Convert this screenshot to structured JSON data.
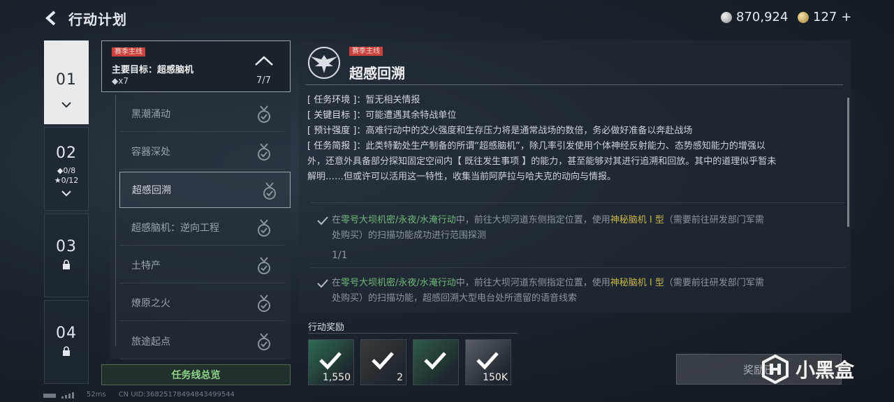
{
  "header": {
    "title": "行动计划",
    "silver": "870,924",
    "gold": "127",
    "gold_plus": "+"
  },
  "chapters": [
    {
      "num": "01",
      "sub1": "",
      "sub2": ""
    },
    {
      "num": "02",
      "sub1": "◆0/8",
      "sub2": "★0/12"
    },
    {
      "num": "03",
      "sub1": "",
      "sub2": ""
    },
    {
      "num": "04",
      "sub1": "",
      "sub2": ""
    }
  ],
  "main_quest": {
    "tag": "赛季主线",
    "title": "主要目标：超感脑机",
    "reward": "◆x7",
    "progress": "7/7"
  },
  "missions": [
    {
      "label": "黑潮涌动"
    },
    {
      "label": "容器深处"
    },
    {
      "label": "超感回溯"
    },
    {
      "label": "超感脑机：逆向工程"
    },
    {
      "label": "土特产"
    },
    {
      "label": "燎原之火"
    },
    {
      "label": "旅途起点"
    }
  ],
  "overview_label": "任务线总览",
  "detail": {
    "tag": "赛季主线",
    "title": "超感回溯",
    "env_k": "[ 任务环境 ]：",
    "env_v": "暂无相关情报",
    "target_k": "[ 关键目标 ]：",
    "target_v": "可能遭遇其余特战单位",
    "strength_k": "[ 预计强度 ]：",
    "strength_v": "高难行动中的交火强度和生存压力将是通常战场的数倍，务必做好准备以奔赴战场",
    "brief_k": "[ 任务简报 ]：",
    "brief_v1": "此类特勤处生产制备的所谓“超感脑机”，除几率引发使用个体神经反射能力、态势感知能力的增强以",
    "brief_v2": "外，还意外具备部分探知固定空间内【 既往发生事项 】的能力，甚至能够对其进行追溯和回放。其中的道理似乎暂未",
    "brief_v3": "解明……但或许可以活用这一特性，收集当前阿萨拉与哈夫克的动向与情报。"
  },
  "objectives": [
    {
      "pre": "在",
      "map": "零号大坝机密/永夜/水淹行动",
      "mid": "中，前往大坝河道东侧指定位置，使用",
      "item": "神秘脑机 I 型",
      "post": "（需要前往研发部门军需",
      "line2": "处购买）的扫描功能成功进行范围探测",
      "progress": "1/1"
    },
    {
      "pre": "在",
      "map": "零号大坝机密/永夜/水淹行动",
      "mid": "中，前往大坝河道东侧指定位置，使用",
      "item": "神秘脑机 I 型",
      "post": "（需要前往研发部门军需",
      "line2": "处购买）的扫描功能，超感回溯大型电台处所遗留的语音线索",
      "progress": ""
    }
  ],
  "rewards": {
    "title": "行动奖励",
    "items": [
      {
        "count": "1,550",
        "color": "#2f6b55"
      },
      {
        "count": "2",
        "color": "#3a3a3a"
      },
      {
        "count": "",
        "color": "#2e5b48"
      },
      {
        "count": "150K",
        "color": "#5a5f66"
      }
    ]
  },
  "claim_label": "奖励已",
  "footer": {
    "ping": "52ms",
    "uid": "CN UID:36825178494843499544"
  },
  "watermark": "小黑盒"
}
